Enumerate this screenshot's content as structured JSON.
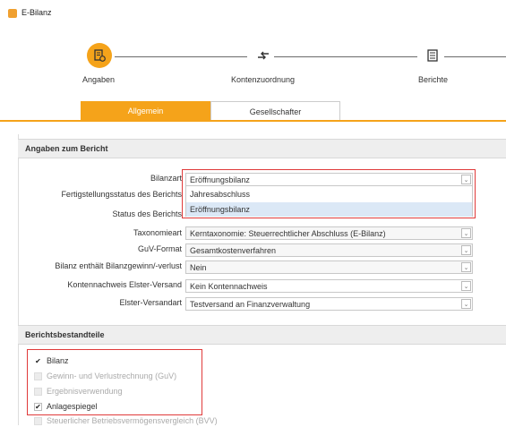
{
  "window": {
    "title": "E-Bilanz",
    "icon": "app-icon"
  },
  "wizard": {
    "steps": [
      {
        "label": "Angaben",
        "icon": "document-gear-icon",
        "active": true
      },
      {
        "label": "Kontenzuordnung",
        "icon": "arrows-exchange-icon",
        "active": false
      },
      {
        "label": "Berichte",
        "icon": "report-icon",
        "active": false
      }
    ]
  },
  "tabs": [
    {
      "label": "Allgemein",
      "active": true
    },
    {
      "label": "Gesellschafter",
      "active": false
    }
  ],
  "colors": {
    "accent": "#f5a31a",
    "highlight_red": "#e03a3a",
    "selected_row": "#dbe8f6"
  },
  "sections": {
    "report_info": {
      "title": "Angaben zum Bericht",
      "fields": [
        {
          "label": "Bilanzart",
          "value": "Eröffnungsbilanz",
          "open": true
        },
        {
          "label": "Fertigstellungsstatus des Berichts",
          "value": ""
        },
        {
          "label": "Status des Berichts",
          "value": ""
        },
        {
          "label": "Taxonomieart",
          "value": "Kerntaxonomie: Steuerrechtlicher Abschluss (E-Bilanz)"
        },
        {
          "label": "GuV-Format",
          "value": "Gesamtkostenverfahren"
        },
        {
          "label": "Bilanz enthält Bilanzgewinn/-verlust",
          "value": "Nein"
        },
        {
          "label": "Kontennachweis Elster-Versand",
          "value": "Kein Kontennachweis"
        },
        {
          "label": "Elster-Versandart",
          "value": "Testversand an Finanzverwaltung"
        }
      ],
      "dropdown_options": [
        {
          "label": "Jahresabschluss",
          "selected": false
        },
        {
          "label": "Eröffnungsbilanz",
          "selected": true
        }
      ]
    },
    "components": {
      "title": "Berichtsbestandteile",
      "items": [
        {
          "label": "Bilanz",
          "checked": true,
          "enabled": true
        },
        {
          "label": "Gewinn- und Verlustrechnung (GuV)",
          "checked": false,
          "enabled": false
        },
        {
          "label": "Ergebnisverwendung",
          "checked": false,
          "enabled": false
        },
        {
          "label": "Anlagespiegel",
          "checked": true,
          "enabled": true
        },
        {
          "label": "Steuerlicher Betriebsvermögensvergleich (BVV)",
          "checked": false,
          "enabled": false
        }
      ]
    }
  }
}
